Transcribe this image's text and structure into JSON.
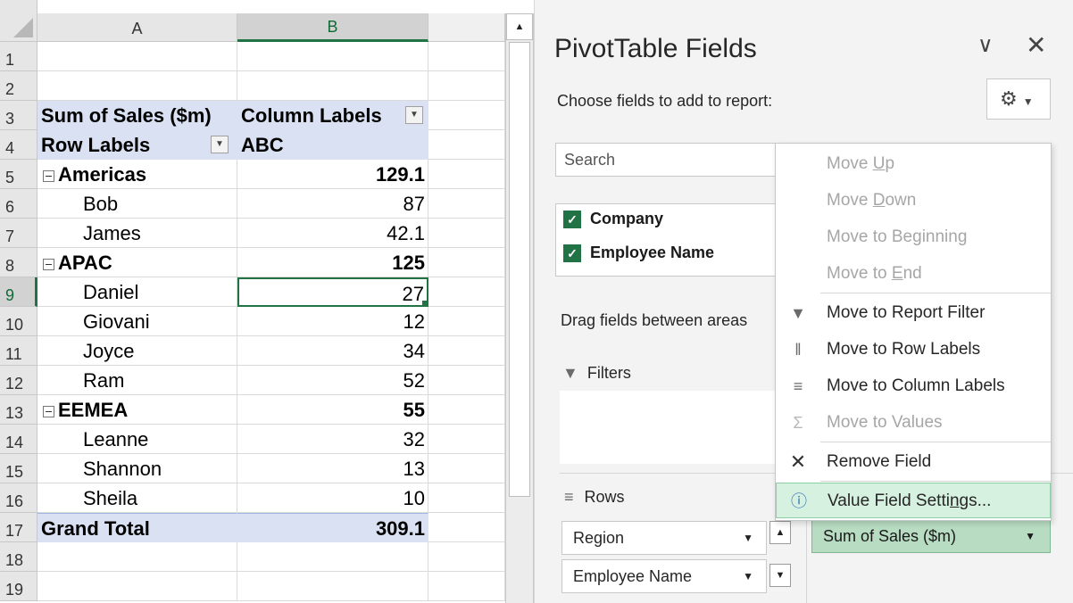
{
  "sheet": {
    "columns": [
      "A",
      "B"
    ],
    "row_numbers": [
      "1",
      "2",
      "3",
      "4",
      "5",
      "6",
      "7",
      "8",
      "9",
      "10",
      "11",
      "12",
      "13",
      "14",
      "15",
      "16",
      "17",
      "18",
      "19"
    ],
    "pivot": {
      "values_header": "Sum of Sales ($m)",
      "column_labels": "Column Labels",
      "row_labels": "Row Labels",
      "column_value": "ABC",
      "rows": [
        {
          "label": "Americas",
          "value": "129.1",
          "level": "region"
        },
        {
          "label": "Bob",
          "value": "87",
          "level": "employee"
        },
        {
          "label": "James",
          "value": "42.1",
          "level": "employee"
        },
        {
          "label": "APAC",
          "value": "125",
          "level": "region"
        },
        {
          "label": "Daniel",
          "value": "27",
          "level": "employee"
        },
        {
          "label": "Giovani",
          "value": "12",
          "level": "employee"
        },
        {
          "label": "Joyce",
          "value": "34",
          "level": "employee"
        },
        {
          "label": "Ram",
          "value": "52",
          "level": "employee"
        },
        {
          "label": "EEMEA",
          "value": "55",
          "level": "region"
        },
        {
          "label": "Leanne",
          "value": "32",
          "level": "employee"
        },
        {
          "label": "Shannon",
          "value": "13",
          "level": "employee"
        },
        {
          "label": "Sheila",
          "value": "10",
          "level": "employee"
        }
      ],
      "grand_total_label": "Grand Total",
      "grand_total_value": "309.1"
    }
  },
  "pane": {
    "title": "PivotTable Fields",
    "subtitle": "Choose fields to add to report:",
    "search_placeholder": "Search",
    "fields": [
      "Company",
      "Employee Name"
    ],
    "drag_text": "Drag fields between areas",
    "filters_label": "Filters",
    "rows_label": "Rows",
    "row_items": [
      "Region",
      "Employee Name"
    ],
    "value_item": "Sum of Sales ($m)"
  },
  "menu": {
    "items": [
      {
        "label": "Move Up",
        "pre": "Move ",
        "key": "U",
        "post": "p",
        "enabled": false,
        "icon": ""
      },
      {
        "label": "Move Down",
        "pre": "Move ",
        "key": "D",
        "post": "own",
        "enabled": false,
        "icon": ""
      },
      {
        "label": "Move to Beginning",
        "pre": "Move to Be",
        "key": "g",
        "post": "inning",
        "enabled": false,
        "icon": ""
      },
      {
        "label": "Move to End",
        "pre": "Move to ",
        "key": "E",
        "post": "nd",
        "enabled": false,
        "icon": ""
      },
      {
        "label": "Move to Report Filter",
        "enabled": true,
        "icon": "filter-icon"
      },
      {
        "label": "Move to Row Labels",
        "enabled": true,
        "icon": "rows-icon"
      },
      {
        "label": "Move to Column Labels",
        "enabled": true,
        "icon": "columns-icon"
      },
      {
        "label": "Move to Values",
        "enabled": false,
        "icon": "sigma-icon"
      },
      {
        "label": "Remove Field",
        "enabled": true,
        "icon": "remove-icon"
      },
      {
        "label": "Value Field Settings...",
        "pre": "Value Field Setti",
        "key": "n",
        "post": "gs...",
        "enabled": true,
        "icon": "settings-info-icon"
      }
    ]
  },
  "colors": {
    "accent": "#217346",
    "pivot_header": "#d9e1f2",
    "menu_hover": "#d7f1e1"
  }
}
